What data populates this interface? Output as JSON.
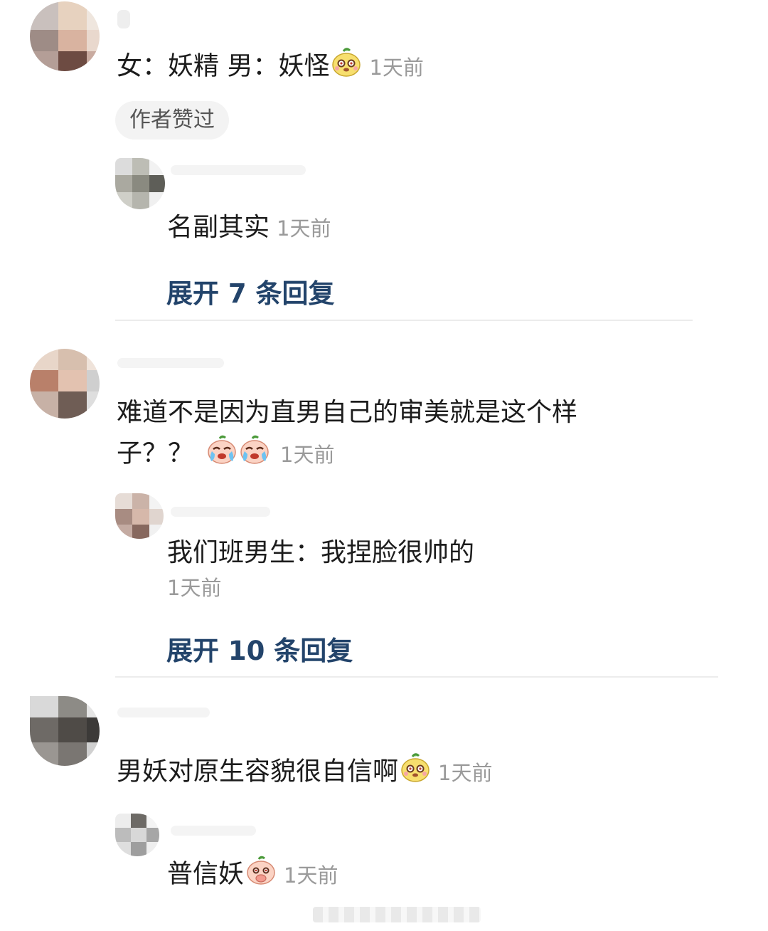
{
  "threads": [
    {
      "comment": {
        "text": "女：妖精  男：妖怪",
        "time": "1天前",
        "emoji": "yellow-face-emoji"
      },
      "author_liked_badge": "作者赞过",
      "reply": {
        "text": "名副其实",
        "time": "1天前"
      },
      "expand_label": "展开 7 条回复"
    },
    {
      "comment": {
        "text_line1": "难道不是因为直男自己的审美就是这个样",
        "text_line2": "子？？",
        "time": "1天前",
        "emoji": "crying-face-emoji"
      },
      "reply": {
        "text": "我们班男生：我捏脸很帅的",
        "time": "1天前"
      },
      "expand_label": "展开 10 条回复"
    },
    {
      "comment": {
        "text": "男妖对原生容貌很自信啊",
        "time": "1天前",
        "emoji": "yellow-face-emoji"
      },
      "reply": {
        "text": "普信妖",
        "time": "1天前",
        "emoji": "cover-mouth-face-emoji"
      }
    }
  ],
  "colors": {
    "expand_link": "#23446b",
    "timestamp": "#9a9a9a",
    "badge_bg": "#f3f3f3"
  }
}
